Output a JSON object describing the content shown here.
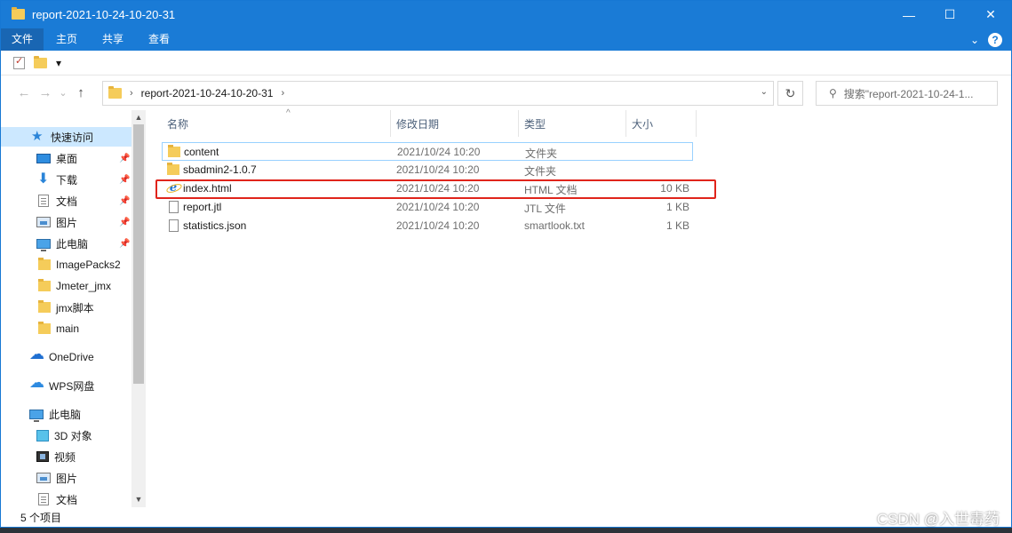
{
  "window": {
    "title": "report-2021-10-24-10-20-31",
    "controls": {
      "minimize": "—",
      "maximize": "☐",
      "close": "✕"
    }
  },
  "ribbon": {
    "tabs": [
      "文件",
      "主页",
      "共享",
      "查看"
    ],
    "expand_glyph": "⌄",
    "help": "?"
  },
  "qat": {
    "dropdown": "▾"
  },
  "address": {
    "back": "←",
    "forward": "→",
    "recent": "⌄",
    "up": "↑",
    "separator": "›",
    "path": "report-2021-10-24-10-20-31",
    "dropdown": "⌄",
    "refresh": "↻"
  },
  "search": {
    "icon": "⚲",
    "placeholder": "搜索\"report-2021-10-24-1..."
  },
  "nav_pane": {
    "quick_access": "快速访问",
    "items": [
      {
        "label": "桌面",
        "icon": "desktop-icon"
      },
      {
        "label": "下载",
        "icon": "download-icon"
      },
      {
        "label": "文档",
        "icon": "document-icon"
      },
      {
        "label": "图片",
        "icon": "picture-icon"
      },
      {
        "label": "此电脑",
        "icon": "computer-icon"
      },
      {
        "label": "ImagePacks2",
        "icon": "folder-icon"
      },
      {
        "label": "Jmeter_jmx",
        "icon": "folder-icon"
      },
      {
        "label": "jmx脚本",
        "icon": "folder-icon"
      },
      {
        "label": "main",
        "icon": "folder-icon"
      }
    ],
    "onedrive": "OneDrive",
    "wps": "WPS网盘",
    "this_pc": "此电脑",
    "pc_items": [
      {
        "label": "3D 对象",
        "icon": "cube-icon"
      },
      {
        "label": "视频",
        "icon": "video-icon"
      },
      {
        "label": "图片",
        "icon": "picture-icon"
      },
      {
        "label": "文档",
        "icon": "document-icon"
      }
    ],
    "pin": "📌",
    "scroll_up": "▲",
    "scroll_down": "▼"
  },
  "columns": {
    "name": "名称",
    "date": "修改日期",
    "type": "类型",
    "size": "大小",
    "sort_glyph": "^"
  },
  "files": [
    {
      "name": "content",
      "date": "2021/10/24 10:20",
      "type": "文件夹",
      "size": "",
      "icon": "folder-icon"
    },
    {
      "name": "sbadmin2-1.0.7",
      "date": "2021/10/24 10:20",
      "type": "文件夹",
      "size": "",
      "icon": "folder-icon"
    },
    {
      "name": "index.html",
      "date": "2021/10/24 10:20",
      "type": "HTML 文档",
      "size": "10 KB",
      "icon": "ie-icon"
    },
    {
      "name": "report.jtl",
      "date": "2021/10/24 10:20",
      "type": "JTL 文件",
      "size": "1 KB",
      "icon": "file-icon"
    },
    {
      "name": "statistics.json",
      "date": "2021/10/24 10:20",
      "type": "smartlook.txt",
      "size": "1 KB",
      "icon": "file-icon"
    }
  ],
  "ie_glyph": "e",
  "status": {
    "item_count": "5 个项目"
  },
  "watermark": "CSDN @入世毒药"
}
